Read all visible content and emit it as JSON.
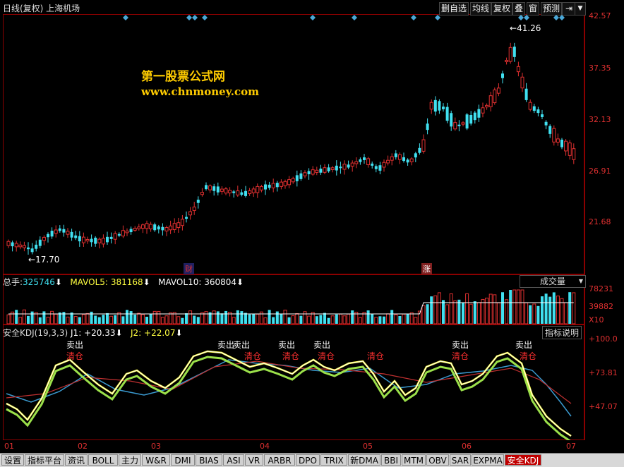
{
  "header": {
    "title": "日线(复权) 上海机场",
    "buttons": [
      "删自选",
      "均线",
      "复权",
      "叠",
      "窗",
      "预测"
    ]
  },
  "price_axis": [
    "42.57",
    "37.35",
    "32.13",
    "26.91",
    "21.68"
  ],
  "annotations": {
    "high": "41.26",
    "low": "17.70",
    "cai": "财",
    "zhang": "涨"
  },
  "watermark": {
    "line1": "第一股票公式网",
    "line2": "www.chnmoney.com"
  },
  "volume_panel": {
    "label1": "总手:",
    "value1": "325746",
    "label2": "MAVOL5:",
    "value2": "381168",
    "label3": "MAVOL10:",
    "value3": "360804",
    "dropdown": "成交量",
    "axis": [
      "78231",
      "39882",
      "X10"
    ]
  },
  "kdj_panel": {
    "label": "安全KDJ(19,3,3)",
    "j1_label": "J1:",
    "j1_value": "+20.33",
    "j2_label": "J2:",
    "j2_value": "+22.07",
    "help": "指标说明",
    "axis": [
      "+100.0",
      "+73.81",
      "+47.07"
    ],
    "sell": "卖出",
    "clear": "清仓"
  },
  "dates": [
    "01",
    "02",
    "03",
    "04",
    "05",
    "06",
    "07"
  ],
  "tabs": [
    "设置",
    "指标平台",
    "资讯",
    "BOLL",
    "主力",
    "W&R",
    "DMI",
    "BIAS",
    "ASI",
    "VR",
    "ARBR",
    "DPO",
    "TRIX",
    "新DMA",
    "BBI",
    "MTM",
    "OBV",
    "SAR",
    "EXPMA",
    "安全KDJ"
  ],
  "colors": {
    "up": "#e03030",
    "down": "#40e0f0",
    "axis": "#8b0000"
  }
}
